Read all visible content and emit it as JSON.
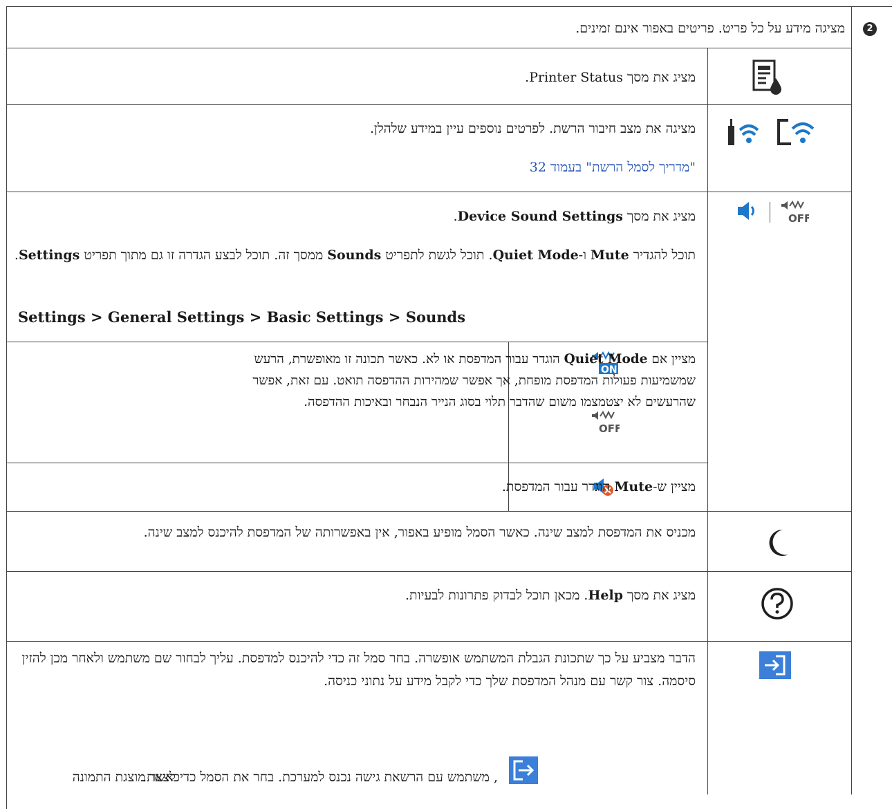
{
  "callout": "2",
  "intro": "מציגה מידע על כל פריט. פריטים באפור אינם זמינים.",
  "printer_status": {
    "prefix": "מציג את מסך ",
    "name": "Printer Status",
    "suffix": "."
  },
  "network": {
    "text": "מציגה את מצב חיבור הרשת. לפרטים נוספים עיין במידע שלהלן.",
    "link": "\"מדריך לסמל הרשת\" בעמוד 32"
  },
  "device_sound": {
    "p1_prefix": "מציג את מסך ",
    "p1_bold": "Device Sound Settings",
    "p1_suffix": ".",
    "p2_a": "תוכל להגדיר ",
    "p2_mute": "Mute",
    "p2_b": " ו-",
    "p2_quiet": "Quiet Mode",
    "p2_c": ". תוכל לגשת לתפריט ",
    "p2_sounds": "Sounds",
    "p2_d": " ממסך זה. תוכל לבצע הגדרה זו גם מתוך תפריט ",
    "p2_settings": "Settings",
    "p2_e": ".",
    "path": "Settings > General Settings > Basic Settings > Sounds"
  },
  "quiet_mode": {
    "a": "מציין אם ",
    "bold": "Quiet Mode",
    "b": " הוגדר עבור המדפסת או לא. כאשר תכונה זו מאופשרת, הרעש שמשמיעות פעולות המדפסת מופחת, אך אפשר שמהירות ההדפסה תואט. עם זאת, אפשר שהרעשים לא יצטמצמו משום שהדבר תלוי בסוג הנייר הנבחר ובאיכות ההדפסה."
  },
  "mute": {
    "a": "מציין ש-",
    "bold": "Mute",
    "b": " הוגדר עבור המדפסת."
  },
  "sleep": {
    "text": "מכניס את המדפסת למצב שינה. כאשר הסמל מופיע באפור, אין באפשרותה של המדפסת להיכנס למצב שינה."
  },
  "help": {
    "a": "מציג את מסך ",
    "bold": "Help",
    "b": ". מכאן תוכל לבדוק פתרונות לבעיות."
  },
  "login": {
    "p1": "הדבר מצביע על כך שתכונת הגבלת המשתמש אופשרה. בחר סמל זה כדי להיכנס למדפסת. עליך לבחור שם משתמש ולאחר מכן להזין סיסמה. צור קשר עם מנהל המדפסת שלך כדי לקבל מידע על נתוני כניסה.",
    "p2_a": "כאשר מוצגת התמונה",
    "p2_b": ", משתמש עם הרשאת גישה נכנס למערכת. בחר את הסמל כדי לצאת."
  },
  "icons": {
    "printer_status": "printer-status-icon",
    "network_router": "router-wifi-icon",
    "network_wifi": "wifi-icon",
    "sound": "speaker-icon",
    "quiet_off": "quiet-mode-off-icon",
    "quiet_on": "quiet-mode-on-icon",
    "mute": "mute-icon",
    "sleep": "moon-icon",
    "help": "help-icon",
    "login": "login-icon",
    "logout": "logout-icon"
  },
  "colors": {
    "link": "#1f4fb5",
    "icon_blue": "#1d78c9",
    "login_bg": "#3b7fd9"
  }
}
